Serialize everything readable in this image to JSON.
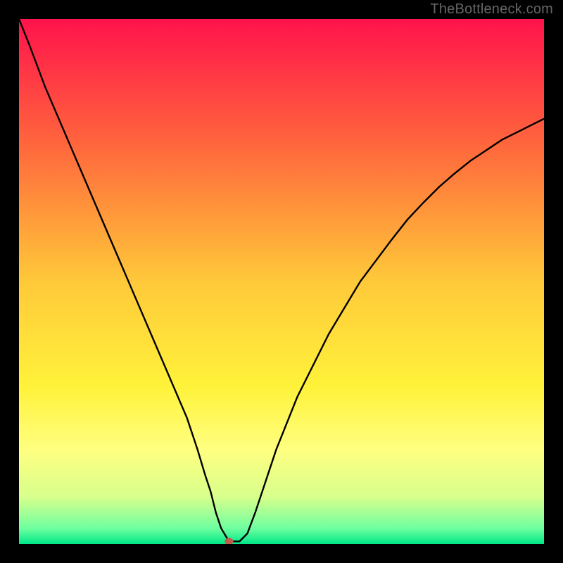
{
  "watermark": "TheBottleneck.com",
  "chart_data": {
    "type": "line",
    "title": "",
    "xlabel": "",
    "ylabel": "",
    "xlim": [
      0,
      100
    ],
    "ylim": [
      0,
      100
    ],
    "x": [
      0,
      2,
      5,
      8,
      11,
      14,
      17,
      20,
      23,
      26,
      29,
      32,
      34,
      35.5,
      36.5,
      37.5,
      38.5,
      40,
      41,
      42,
      43.5,
      45,
      47,
      49,
      51,
      53,
      56,
      59,
      62,
      65,
      68,
      71,
      74,
      77,
      80,
      83,
      86,
      89,
      92,
      95,
      98,
      100
    ],
    "values": [
      100,
      95,
      87,
      80,
      73,
      66,
      59,
      52,
      45,
      38,
      31,
      24,
      18,
      13,
      10,
      6,
      3,
      0.5,
      0.5,
      0.5,
      2,
      6,
      12,
      18,
      23,
      28,
      34,
      40,
      45,
      50,
      54,
      58,
      61.8,
      65,
      68,
      70.6,
      73,
      75,
      77,
      78.5,
      80,
      81
    ],
    "marker": {
      "x": 40,
      "y": 0.5
    },
    "background_gradient": {
      "stops": [
        {
          "pos": 0.0,
          "color": "#ff134b"
        },
        {
          "pos": 0.25,
          "color": "#ff6a3c"
        },
        {
          "pos": 0.5,
          "color": "#ffc93a"
        },
        {
          "pos": 0.7,
          "color": "#fff23a"
        },
        {
          "pos": 0.82,
          "color": "#ffff80"
        },
        {
          "pos": 0.91,
          "color": "#d8ff8c"
        },
        {
          "pos": 0.97,
          "color": "#6fff9f"
        },
        {
          "pos": 1.0,
          "color": "#00e787"
        }
      ]
    }
  }
}
